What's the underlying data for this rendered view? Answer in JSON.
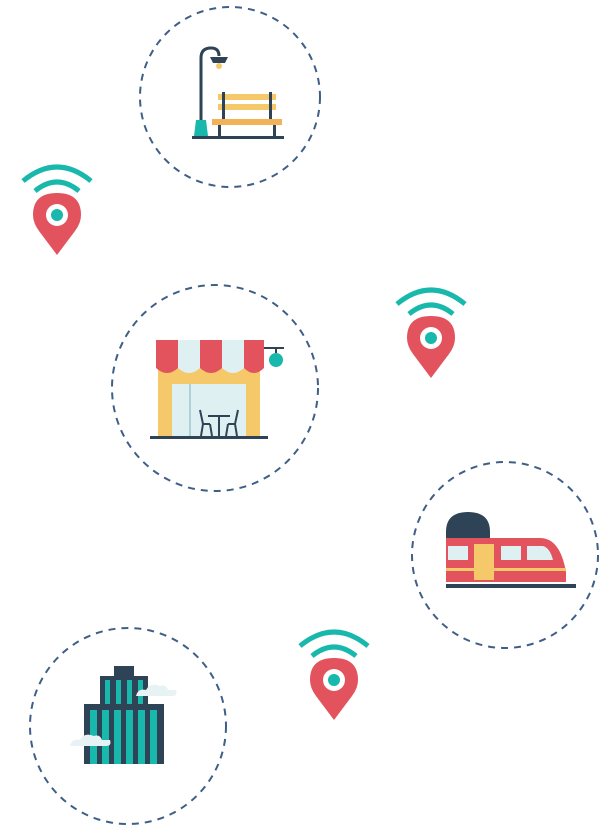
{
  "scene": {
    "locations": [
      {
        "name": "park-bench-with-street-lamp",
        "icon": "park-bench-icon"
      },
      {
        "name": "cafe-storefront",
        "icon": "cafe-icon"
      },
      {
        "name": "train-station",
        "icon": "train-icon"
      },
      {
        "name": "office-building",
        "icon": "building-icon"
      }
    ],
    "markers": [
      {
        "icon": "wifi-location-pin-icon"
      },
      {
        "icon": "wifi-location-pin-icon"
      },
      {
        "icon": "wifi-location-pin-icon"
      }
    ]
  },
  "colors": {
    "ring": "#3f5f86",
    "pin_red": "#e2535e",
    "wifi_teal": "#18b8ac",
    "navy": "#2f4356",
    "yellow": "#f5c86a",
    "bench_orange": "#f2b257",
    "light_blue": "#dff0f3"
  }
}
